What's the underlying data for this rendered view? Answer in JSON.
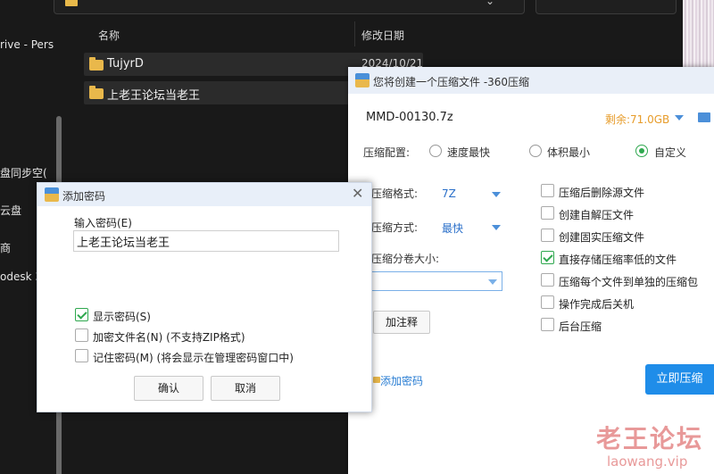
{
  "explorer": {
    "nav_items": [
      "rive - Pers",
      "盘同步空(",
      "云盘",
      "商",
      "odesk 3"
    ],
    "columns": {
      "name": "名称",
      "modified": "修改日期"
    },
    "files": [
      {
        "name": "TujyrD",
        "date": "2024/10/21"
      },
      {
        "name": "上老王论坛当老王",
        "date": ""
      }
    ]
  },
  "zip_window": {
    "title": "您将创建一个压缩文件 -360压缩",
    "filename": "MMD-00130.7z",
    "free_space": "剩余:71.0GB",
    "config_label": "压缩配置:",
    "config_options": [
      {
        "label": "速度最快",
        "selected": false
      },
      {
        "label": "体积最小",
        "selected": false
      },
      {
        "label": "自定义",
        "selected": true
      }
    ],
    "format_label": "压缩格式:",
    "format_value": "7Z",
    "method_label": "压缩方式:",
    "method_value": "最快",
    "volume_label": "压缩分卷大小:",
    "volume_value": "",
    "comment_button": "加注释",
    "options": [
      {
        "label": "压缩后删除源文件",
        "checked": false
      },
      {
        "label": "创建自解压文件",
        "checked": false
      },
      {
        "label": "创建固实压缩文件",
        "checked": false
      },
      {
        "label": "直接存储压缩率低的文件",
        "checked": true
      },
      {
        "label": "压缩每个文件到单独的压缩包",
        "checked": false
      },
      {
        "label": "操作完成后关机",
        "checked": false
      },
      {
        "label": "后台压缩",
        "checked": false
      }
    ],
    "add_password_link": "添加密码",
    "compress_button": "立即压缩"
  },
  "password_dialog": {
    "title": "添加密码",
    "input_label": "输入密码(E)",
    "password_value": "上老王论坛当老王",
    "options": [
      {
        "label": "显示密码(S)",
        "checked": true
      },
      {
        "label": "加密文件名(N) (不支持ZIP格式)",
        "checked": false
      },
      {
        "label": "记住密码(M) (将会显示在管理密码窗口中)",
        "checked": false
      }
    ],
    "ok_button": "确认",
    "cancel_button": "取消",
    "close_glyph": "✕"
  },
  "watermark": {
    "cn": "老王论坛",
    "en": "laowang.vip"
  },
  "colors": {
    "accent": "#1f8de9",
    "checked": "#2fa84f",
    "free_space": "#e79c2a",
    "link": "#2a7ed3"
  }
}
